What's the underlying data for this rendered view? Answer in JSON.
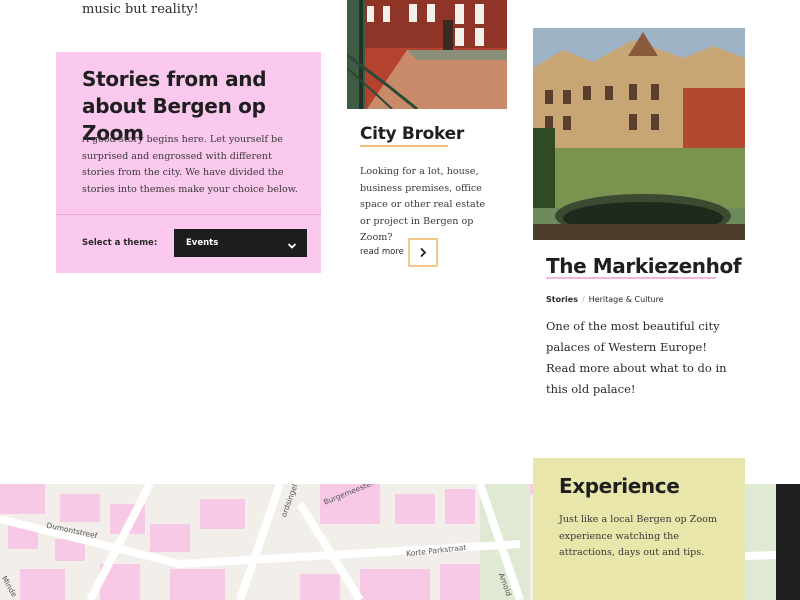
{
  "intro": {
    "tail_text": "music but reality!"
  },
  "stories": {
    "title": "Stories from and about Bergen op Zoom",
    "text": "A good story begins here. Let yourself be surprised and engrossed with different stories from the city. We have divided the stories into themes make your choice below.",
    "theme_label": "Select a theme:",
    "theme_selected": "Events",
    "bg_color": "#fbc8ee"
  },
  "city_broker": {
    "title": "City Broker",
    "text": "Looking for a lot, house, business premises, office space or other real estate or project in Bergen op Zoom?",
    "read_more": "read more",
    "accent_color": "#f5c78a"
  },
  "markiezenhof": {
    "title": "The Markiezenhof",
    "tag_primary": "Stories",
    "tag_secondary": "Heritage & Culture",
    "text": "One of the most beautiful city palaces of Western Europe! Read more about what to do in this old palace!",
    "accent_color": "#f2b3e5"
  },
  "experience": {
    "title": "Experience",
    "text": "Just like a local Bergen op Zoom experience watching the attractions, days out and tips.",
    "bg_color": "#e8e6aa"
  },
  "map": {
    "street_labels": [
      "Dumontstreef",
      "Korte Parkstraat",
      "Burgemeester",
      "ordsingel",
      "Arnold",
      "Minde"
    ]
  },
  "icons": {
    "theme_select_icon": "chevron-down-icon",
    "read_more_icon": "chevron-right-icon"
  }
}
